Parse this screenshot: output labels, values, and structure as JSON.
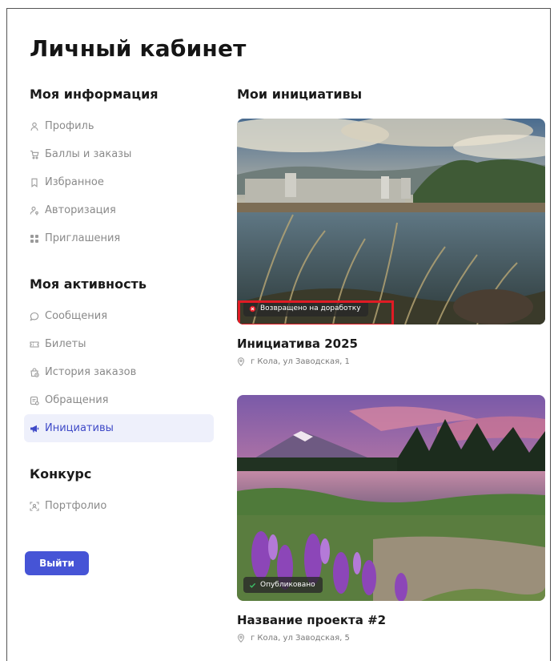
{
  "page": {
    "title": "Личный кабинет"
  },
  "sidebar": {
    "my_info": {
      "title": "Моя информация",
      "items": [
        {
          "label": "Профиль",
          "icon": "user-icon"
        },
        {
          "label": "Баллы и заказы",
          "icon": "cart-icon"
        },
        {
          "label": "Избранное",
          "icon": "bookmark-icon"
        },
        {
          "label": "Авторизация",
          "icon": "user-key-icon"
        },
        {
          "label": "Приглашения",
          "icon": "grid-icon"
        }
      ]
    },
    "my_activity": {
      "title": "Моя активность",
      "items": [
        {
          "label": "Сообщения",
          "icon": "chat-icon"
        },
        {
          "label": "Билеты",
          "icon": "ticket-icon"
        },
        {
          "label": "История заказов",
          "icon": "order-history-icon"
        },
        {
          "label": "Обращения",
          "icon": "appeal-icon"
        },
        {
          "label": "Инициативы",
          "icon": "megaphone-icon",
          "active": true
        }
      ]
    },
    "contest": {
      "title": "Конкурс",
      "items": [
        {
          "label": "Портфолио",
          "icon": "portfolio-icon"
        }
      ]
    },
    "logout_label": "Выйти"
  },
  "main": {
    "title": "Мои инициативы",
    "cards": [
      {
        "title": "Инициатива 2025",
        "address": "г Кола, ул Заводская, 1",
        "status": "Возвращено на доработку",
        "status_color": "#e01b24"
      },
      {
        "title": "Название проекта #2",
        "address": "г Кола, ул Заводская, 5",
        "status": "Опубликовано",
        "status_color": "#3cc46a"
      }
    ]
  },
  "colors": {
    "accent": "#4654d6",
    "active_bg": "#eef0fb",
    "highlight": "#e01b24"
  }
}
